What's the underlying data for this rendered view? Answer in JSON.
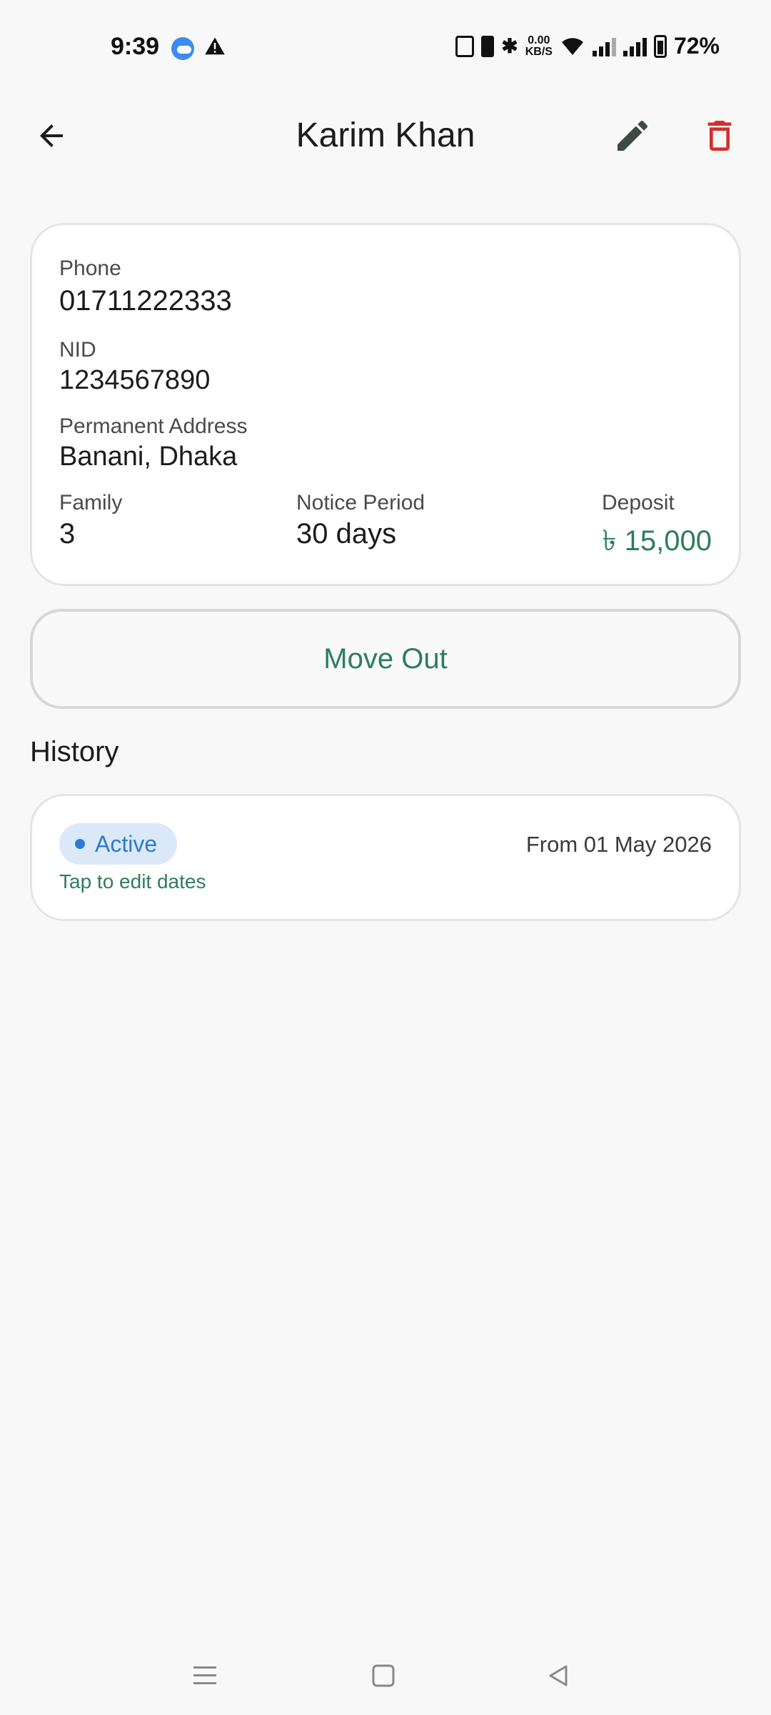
{
  "status": {
    "time": "9:39",
    "net_speed_top": "0.00",
    "net_speed_bottom": "KB/S",
    "battery": "72%"
  },
  "appbar": {
    "title": "Karim Khan",
    "back_icon": "arrow-back-icon",
    "edit_icon": "pencil-icon",
    "delete_icon": "trash-icon"
  },
  "tenant": {
    "phone_label": "Phone",
    "phone_value": "01711222333",
    "nid_label": "NID",
    "nid_value": "1234567890",
    "address_label": "Permanent Address",
    "address_value": "Banani, Dhaka",
    "family_label": "Family",
    "family_value": "3",
    "notice_label": "Notice Period",
    "notice_value": "30 days",
    "deposit_label": "Deposit",
    "deposit_value": "৳ 15,000"
  },
  "actions": {
    "move_out": "Move Out"
  },
  "history": {
    "title": "History",
    "items": [
      {
        "status": "Active",
        "hint": "Tap to edit dates",
        "from": "From 01 May 2026"
      }
    ]
  },
  "colors": {
    "accent_green": "#2e7d5b",
    "delete_red": "#d32f2f",
    "chip_bg": "#dbe8f7",
    "chip_text": "#2d7ad2"
  }
}
